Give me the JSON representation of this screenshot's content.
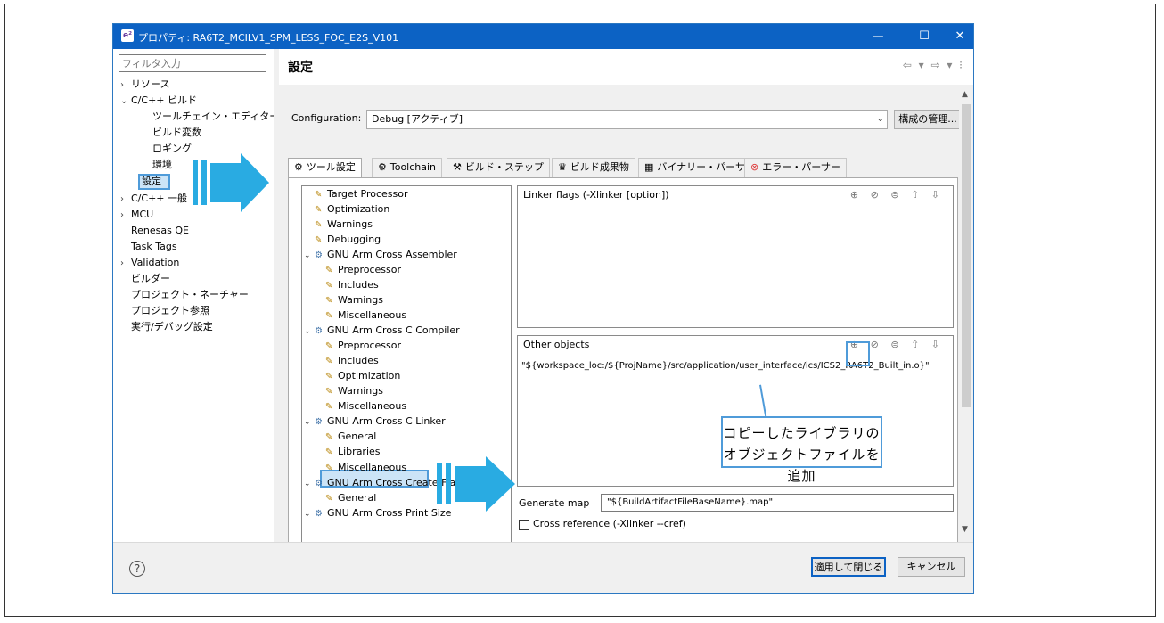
{
  "window": {
    "app_icon": "e²",
    "title": "プロパティ: RA6T2_MCILV1_SPM_LESS_FOC_E2S_V101",
    "min_glyph": "—",
    "max_glyph": "☐",
    "close_glyph": "✕"
  },
  "sidebar": {
    "filter_placeholder": "フィルタ入力",
    "items": [
      {
        "arrow": "›",
        "label": "リソース"
      },
      {
        "arrow": "⌄",
        "label": "C/C++ ビルド"
      },
      {
        "arrow": "",
        "label": "ツールチェイン・エディター"
      },
      {
        "arrow": "",
        "label": "ビルド変数"
      },
      {
        "arrow": "",
        "label": "ロギング"
      },
      {
        "arrow": "",
        "label": "環境"
      },
      {
        "arrow": "",
        "label": "設定"
      },
      {
        "arrow": "›",
        "label": "C/C++ 一般"
      },
      {
        "arrow": "›",
        "label": "MCU"
      },
      {
        "arrow": "",
        "label": "Renesas QE"
      },
      {
        "arrow": "",
        "label": "Task Tags"
      },
      {
        "arrow": "›",
        "label": "Validation"
      },
      {
        "arrow": "",
        "label": "ビルダー"
      },
      {
        "arrow": "",
        "label": "プロジェクト・ネーチャー"
      },
      {
        "arrow": "",
        "label": "プロジェクト参照"
      },
      {
        "arrow": "",
        "label": "実行/デバッグ設定"
      }
    ]
  },
  "header": {
    "title": "設定",
    "nav": "⇦ ▾ ⇨ ▾ ⁝"
  },
  "config": {
    "label": "Configuration:",
    "value": "Debug [アクティブ]",
    "manage_button": "構成の管理..."
  },
  "tabs": [
    {
      "icon": "⚙",
      "label": "ツール設定"
    },
    {
      "icon": "⚙",
      "label": "Toolchain"
    },
    {
      "icon": "⚒",
      "label": "ビルド・ステップ"
    },
    {
      "icon": "♛",
      "label": "ビルド成果物"
    },
    {
      "icon": "▦",
      "label": "バイナリー・パーサー"
    },
    {
      "icon": "⊗",
      "label": "エラー・パーサー"
    }
  ],
  "tool_tree": [
    {
      "level": 1,
      "label": "Target Processor"
    },
    {
      "level": 1,
      "label": "Optimization"
    },
    {
      "level": 1,
      "label": "Warnings"
    },
    {
      "level": 1,
      "label": "Debugging"
    },
    {
      "level": 0,
      "label": "GNU Arm Cross Assembler"
    },
    {
      "level": 1,
      "label": "Preprocessor"
    },
    {
      "level": 1,
      "label": "Includes"
    },
    {
      "level": 1,
      "label": "Warnings"
    },
    {
      "level": 1,
      "label": "Miscellaneous"
    },
    {
      "level": 0,
      "label": "GNU Arm Cross C Compiler"
    },
    {
      "level": 1,
      "label": "Preprocessor"
    },
    {
      "level": 1,
      "label": "Includes"
    },
    {
      "level": 1,
      "label": "Optimization"
    },
    {
      "level": 1,
      "label": "Warnings"
    },
    {
      "level": 1,
      "label": "Miscellaneous"
    },
    {
      "level": 0,
      "label": "GNU Arm Cross C Linker"
    },
    {
      "level": 1,
      "label": "General"
    },
    {
      "level": 1,
      "label": "Libraries"
    },
    {
      "level": 1,
      "label": "Miscellaneous"
    },
    {
      "level": 0,
      "label": "GNU Arm Cross Create Flash Imag"
    },
    {
      "level": 1,
      "label": "General"
    },
    {
      "level": 0,
      "label": "GNU Arm Cross Print Size"
    }
  ],
  "linker_flags": {
    "label": "Linker flags (-Xlinker [option])",
    "icons": "⊕ ⊘ ⊜ ⇧ ⇩"
  },
  "other_objects": {
    "label": "Other objects",
    "icons": "⊕ ⊘ ⊜ ⇧ ⇩",
    "value": "\"${workspace_loc:/${ProjName}/src/application/user_interface/ics/ICS2_RA6T2_Built_in.o}\""
  },
  "generate_map": {
    "label": "Generate map",
    "value": "\"${BuildArtifactFileBaseName}.map\""
  },
  "cross_reference": {
    "label": "Cross reference (-Xlinker --cref)"
  },
  "footer": {
    "help": "?",
    "apply_close": "適用して閉じる",
    "cancel": "キャンセル"
  },
  "callout": {
    "line1": "コピーしたライブラリの",
    "line2": "オブジェクトファイルを追加"
  },
  "colors": {
    "titlebar": "#0c62c4",
    "annotation": "#4f9bd9",
    "arrow": "#29abe2"
  }
}
